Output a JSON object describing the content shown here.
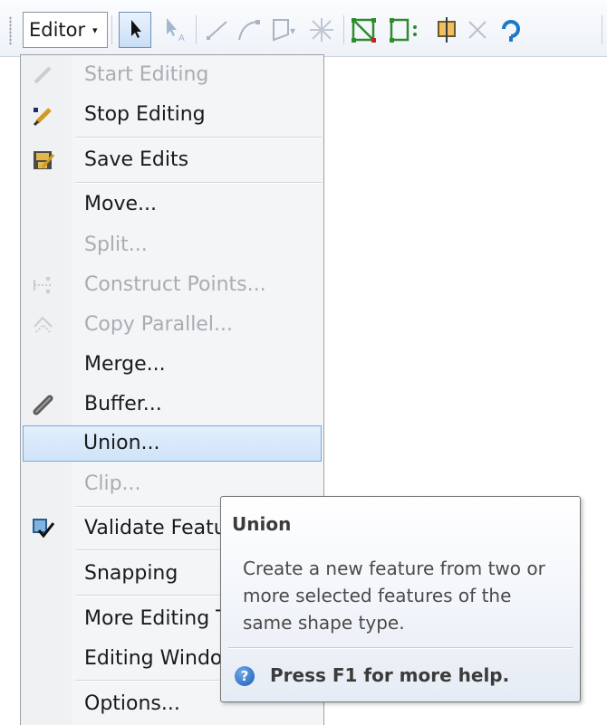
{
  "toolbar": {
    "editor_label": "Editor",
    "dropdown_caret": "▾",
    "icons": [
      "edit-tool-icon",
      "edit-annotation-icon",
      "straight-segment-icon",
      "endpoint-arc-icon",
      "trace-icon",
      "point-icon",
      "edit-vertices-icon",
      "reshape-feature-icon",
      "cut-polygons-icon",
      "split-tool-icon",
      "rotate-icon"
    ]
  },
  "menu": {
    "items": [
      {
        "label": "Start Editing",
        "enabled": false,
        "icon": "start-editing-icon"
      },
      {
        "label": "Stop Editing",
        "enabled": true,
        "icon": "stop-editing-icon"
      },
      {
        "label": "Save Edits",
        "enabled": true,
        "icon": "save-edits-icon"
      },
      {
        "label": "Move...",
        "enabled": true,
        "icon": ""
      },
      {
        "label": "Split...",
        "enabled": false,
        "icon": ""
      },
      {
        "label": "Construct Points...",
        "enabled": false,
        "icon": "construct-points-icon"
      },
      {
        "label": "Copy Parallel...",
        "enabled": false,
        "icon": "copy-parallel-icon"
      },
      {
        "label": "Merge...",
        "enabled": true,
        "icon": ""
      },
      {
        "label": "Buffer...",
        "enabled": true,
        "icon": "buffer-icon"
      },
      {
        "label": "Union...",
        "enabled": true,
        "icon": "",
        "highlighted": true
      },
      {
        "label": "Clip...",
        "enabled": false,
        "icon": ""
      },
      {
        "label": "Validate Featu",
        "enabled": true,
        "icon": "validate-features-icon"
      },
      {
        "label": "Snapping",
        "enabled": true,
        "icon": ""
      },
      {
        "label": "More Editing T",
        "enabled": true,
        "icon": ""
      },
      {
        "label": "Editing Windo",
        "enabled": true,
        "icon": ""
      },
      {
        "label": "Options...",
        "enabled": true,
        "icon": ""
      }
    ]
  },
  "tooltip": {
    "title": "Union",
    "body_lines": [
      "Create a new feature from two or",
      "more selected features of the",
      "same shape type."
    ],
    "help_icon_glyph": "?",
    "help": "Press F1 for more help."
  },
  "colors": {
    "highlight": "#cfe3f8",
    "highlight_border": "#7aa7d8",
    "disabled_text": "#a9adb3"
  }
}
